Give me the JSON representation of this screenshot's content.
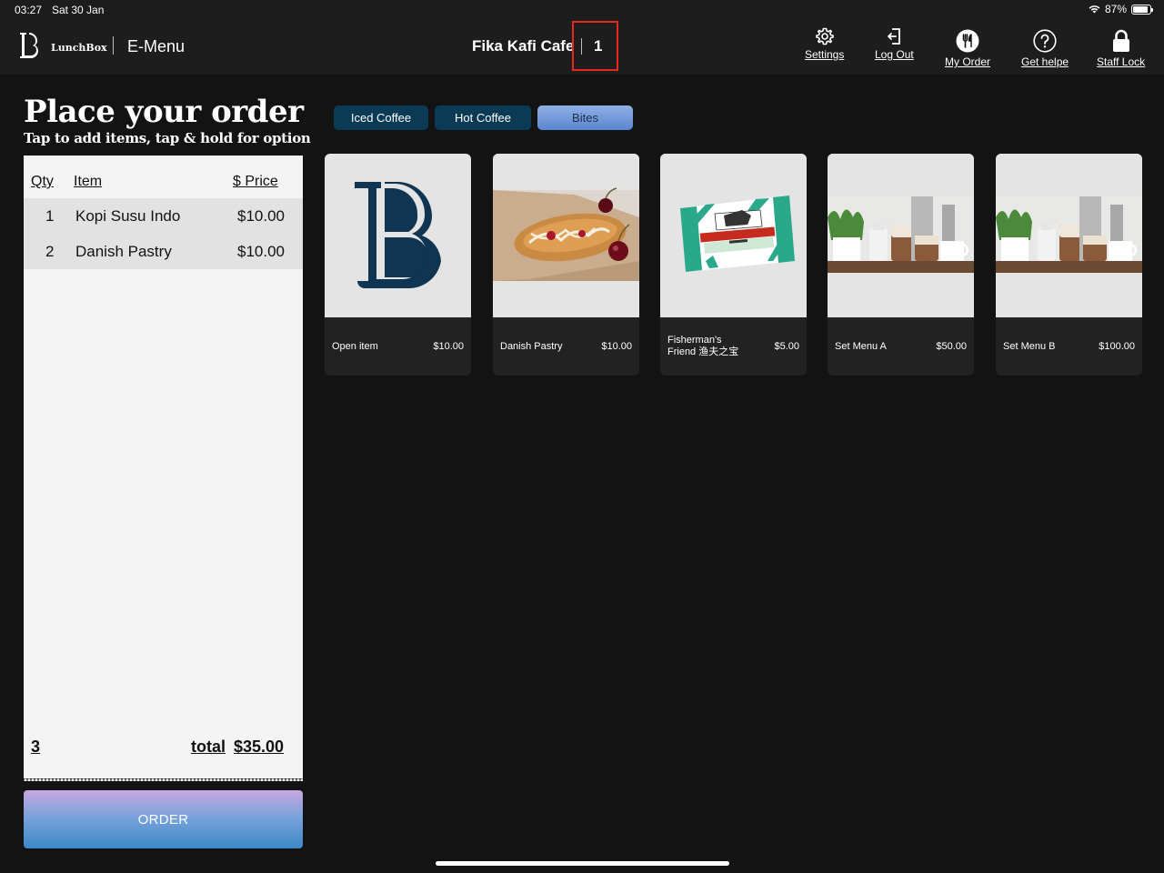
{
  "status_bar": {
    "time": "03:27",
    "date": "Sat 30 Jan",
    "battery": "87%",
    "battery_level": 0.87
  },
  "header": {
    "brand": "LunchBox",
    "app_name": "E-Menu",
    "cafe_name": "Fika Kafi Cafe",
    "table_number": "1",
    "buttons": {
      "settings": "Settings",
      "logout": "Log Out",
      "my_order": "My Order",
      "help": "Get helpe",
      "staff_lock": "Staff Lock"
    }
  },
  "page": {
    "title": "Place your order",
    "subtitle": "Tap to add items, tap & hold for option"
  },
  "tabs": [
    {
      "label": "Iced Coffee",
      "active": false
    },
    {
      "label": "Hot Coffee",
      "active": false
    },
    {
      "label": "Bites",
      "active": true
    }
  ],
  "order": {
    "headers": {
      "qty": "Qty",
      "item": "Item",
      "price": "$ Price"
    },
    "rows": [
      {
        "qty": "1",
        "item": "Kopi Susu Indo",
        "price": "$10.00"
      },
      {
        "qty": "2",
        "item": "Danish Pastry",
        "price": "$10.00"
      }
    ],
    "count": "3",
    "total_label": "total",
    "total": "$35.00",
    "order_button": "ORDER"
  },
  "menu_items": [
    {
      "name": "Open item",
      "price": "$10.00",
      "image": "lunchbox-logo"
    },
    {
      "name": "Danish Pastry",
      "price": "$10.00",
      "image": "danish-pastry-photo"
    },
    {
      "name": "Fisherman's Friend 渔夫之宝",
      "price": "$5.00",
      "image": "fishermans-friend-pack"
    },
    {
      "name": "Set Menu A",
      "price": "$50.00",
      "image": "iced-coffee-photo"
    },
    {
      "name": "Set Menu B",
      "price": "$100.00",
      "image": "iced-coffee-photo"
    }
  ],
  "colors": {
    "background": "#131313",
    "header": "#1d1d1d",
    "tab": "#0b3a55",
    "highlight": "#e8281d",
    "brand_navy": "#0f3552"
  }
}
